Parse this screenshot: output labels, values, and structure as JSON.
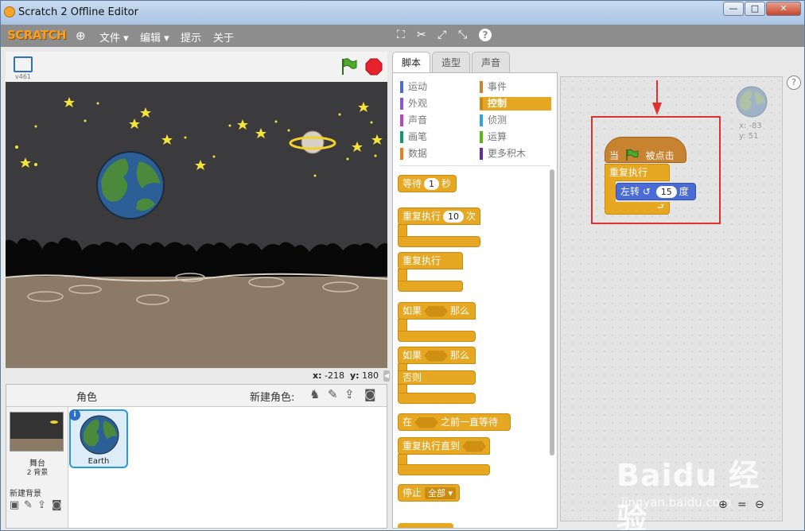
{
  "window": {
    "title": "Scratch 2 Offline Editor",
    "controls": [
      "—",
      "□",
      "✕"
    ]
  },
  "menubar": {
    "logo": "SCRATCH",
    "items": [
      "文件 ▾",
      "编辑 ▾",
      "提示",
      "关于"
    ],
    "tools": [
      "duplicate-icon",
      "delete-icon",
      "grow-icon",
      "shrink-icon",
      "help-icon"
    ]
  },
  "stage": {
    "version": "v461",
    "x_label": "x:",
    "x_value": "-218",
    "y_label": "y:",
    "y_value": "180"
  },
  "sprites_pane": {
    "header": "角色",
    "new_sprite_label": "新建角色:",
    "stage_label": "舞台",
    "backdrops_count": "2 背景",
    "new_backdrop_label": "新建背景",
    "sprite_name": "Earth"
  },
  "tabs": [
    "脚本",
    "造型",
    "声音"
  ],
  "categories": {
    "left": [
      {
        "label": "运动",
        "color": "#4a6cd4"
      },
      {
        "label": "外观",
        "color": "#8a55d7"
      },
      {
        "label": "声音",
        "color": "#bb42c3"
      },
      {
        "label": "画笔",
        "color": "#0e9a6c"
      },
      {
        "label": "数据",
        "color": "#ee7d16"
      }
    ],
    "right": [
      {
        "label": "事件",
        "color": "#c88330"
      },
      {
        "label": "控制",
        "color": "#e6a822"
      },
      {
        "label": "侦测",
        "color": "#2ca5e2"
      },
      {
        "label": "运算",
        "color": "#5cb712"
      },
      {
        "label": "更多积木",
        "color": "#632d99"
      }
    ]
  },
  "palette_blocks": {
    "wait": {
      "label": "等待",
      "value": "1",
      "unit": "秒"
    },
    "repeat": {
      "label": "重复执行",
      "value": "10",
      "unit": "次"
    },
    "forever": {
      "label": "重复执行"
    },
    "if_then": {
      "label": "如果",
      "then": "那么"
    },
    "if_else": {
      "label": "如果",
      "then": "那么",
      "else": "否则"
    },
    "wait_until": {
      "prefix": "在",
      "suffix": "之前一直等待"
    },
    "repeat_until": {
      "label": "重复执行直到"
    },
    "stop": {
      "label": "停止",
      "option": "全部 ▾"
    }
  },
  "script": {
    "hat_prefix": "当",
    "hat_suffix": "被点击",
    "forever_label": "重复执行",
    "turn_label": "左转",
    "turn_value": "15",
    "turn_unit": "度"
  },
  "sprite_info": {
    "x": "x: -83",
    "y": "y: 51"
  },
  "watermark": {
    "brand": "Baidu 经验",
    "url": "jingyan.baidu.com"
  },
  "colors": {
    "control": "#e6a822",
    "events": "#c88330",
    "motion": "#4a6cd4",
    "highlight": "#e03030"
  }
}
